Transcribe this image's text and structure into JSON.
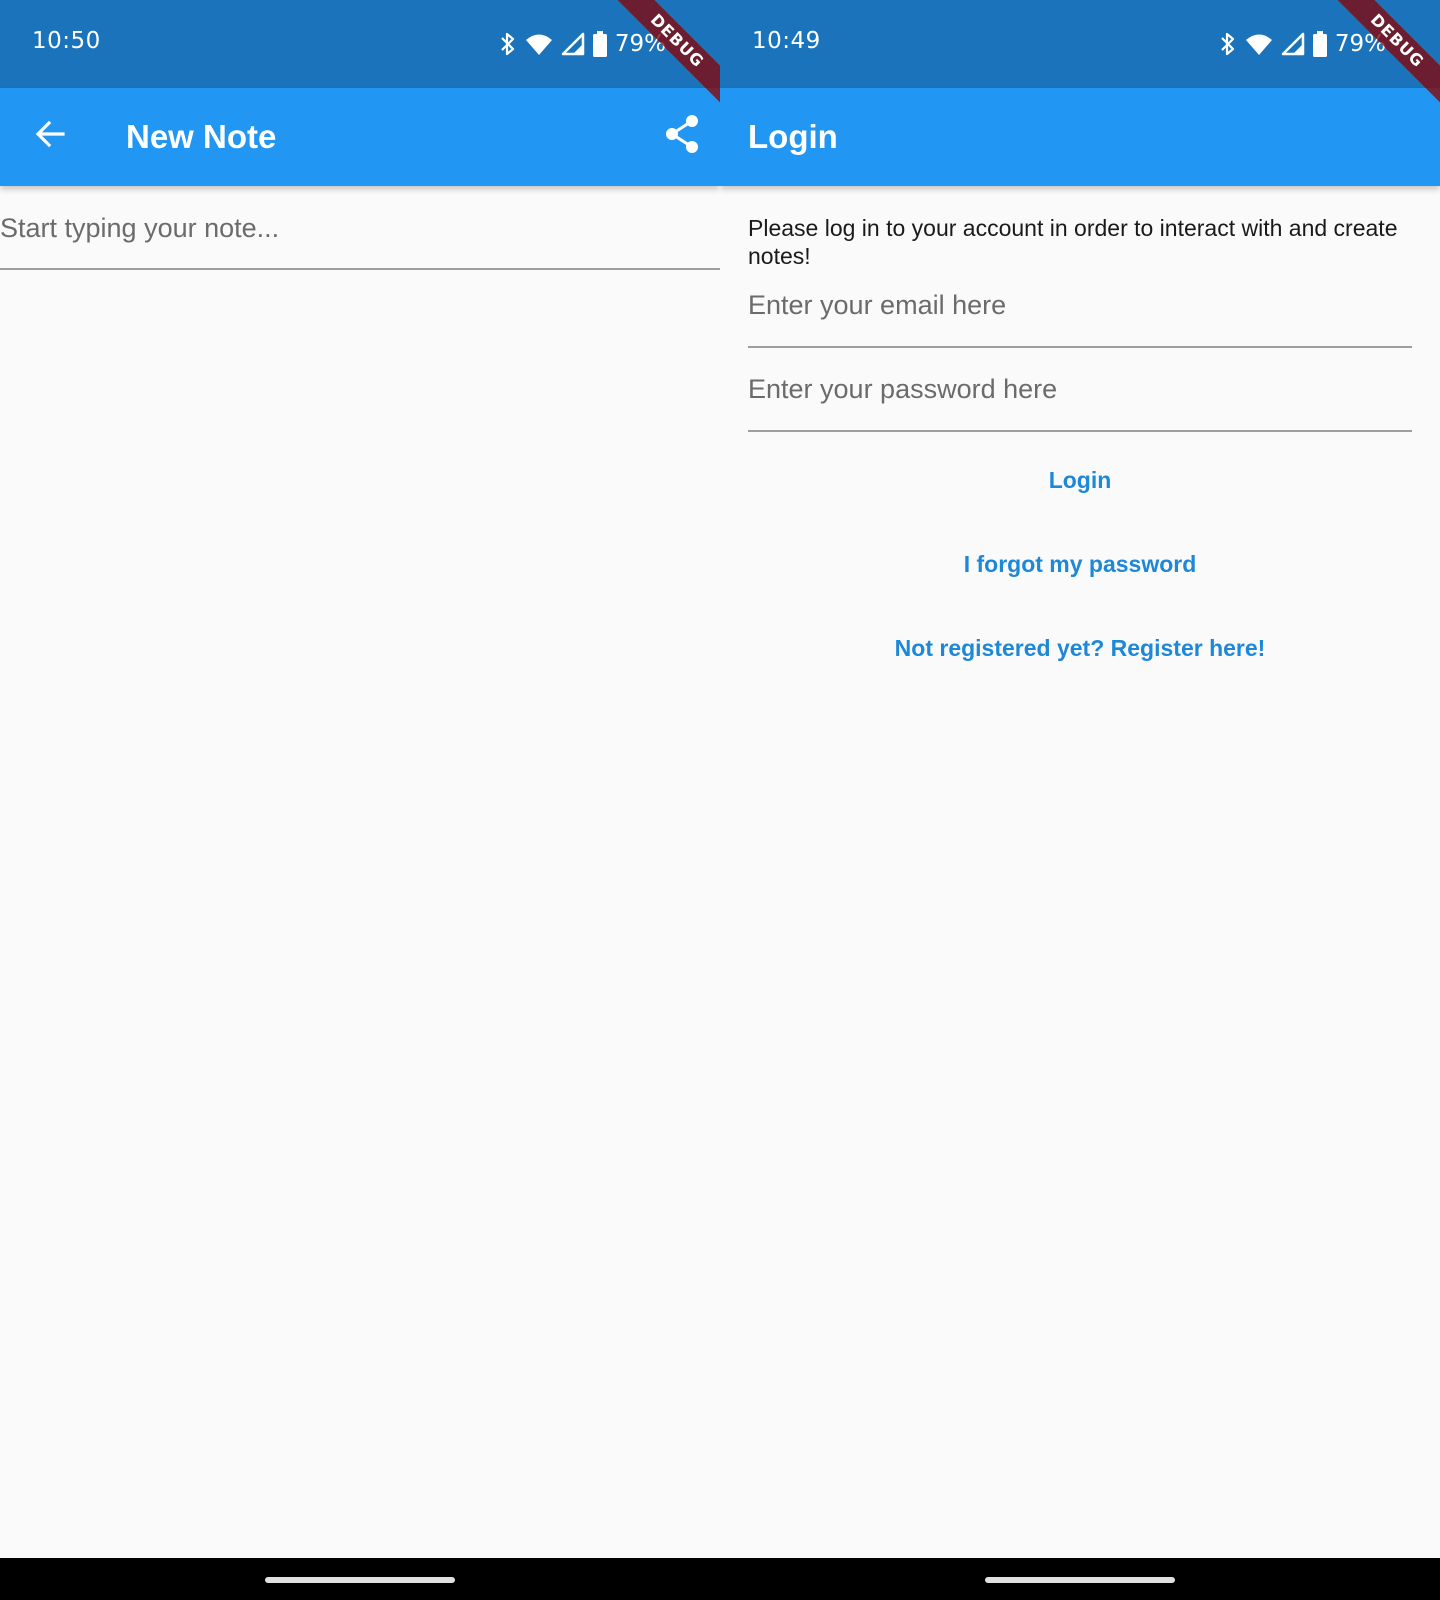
{
  "left_screen": {
    "status": {
      "time": "10:50",
      "battery": "79%"
    },
    "appbar": {
      "title": "New Note"
    },
    "debug_label": "DEBUG",
    "note": {
      "placeholder": "Start typing your note...",
      "value": ""
    }
  },
  "right_screen": {
    "status": {
      "time": "10:49",
      "battery": "79%"
    },
    "appbar": {
      "title": "Login"
    },
    "debug_label": "DEBUG",
    "intro_text": "Please log in to your account in order to interact with and create notes!",
    "email": {
      "placeholder": "Enter your email here",
      "value": ""
    },
    "password": {
      "placeholder": "Enter your password here",
      "value": ""
    },
    "buttons": {
      "login": "Login",
      "forgot": "I forgot my password",
      "register": "Not registered yet? Register here!"
    }
  },
  "colors": {
    "statusbar": "#1b74bb",
    "appbar": "#2196f3",
    "link": "#1e88d8",
    "background": "#fafafa"
  },
  "icons": [
    "bluetooth-icon",
    "wifi-icon",
    "cell-signal-icon",
    "battery-icon",
    "back-arrow-icon",
    "share-icon"
  ]
}
